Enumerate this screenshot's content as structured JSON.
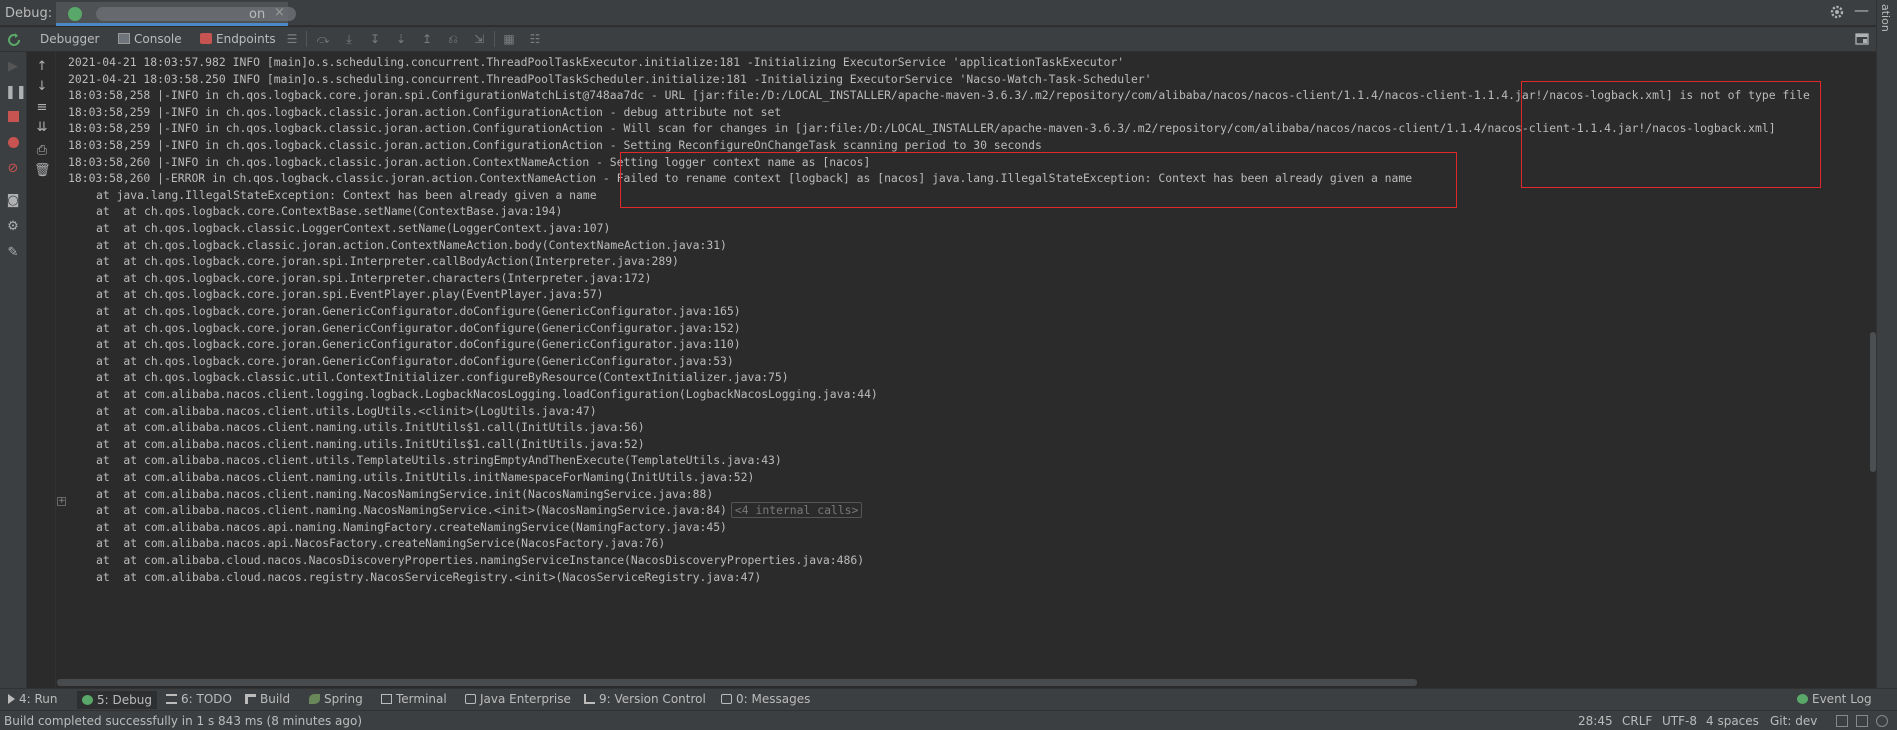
{
  "titlebar": {
    "debug_label": "Debug:",
    "run_tab_name_suffix": "on",
    "close_glyph": "×",
    "minimize_glyph": "—"
  },
  "right_strip": {
    "label": "ation"
  },
  "toolbar2": {
    "tabs": [
      {
        "label": "Debugger"
      },
      {
        "label": "Console"
      },
      {
        "label": "Endpoints"
      }
    ],
    "menu_glyph": "☰"
  },
  "console": {
    "lines": [
      {
        "text": "2021-04-21 18:03:57.982 INFO [main]o.s.scheduling.concurrent.ThreadPoolTaskExecutor.initialize:181 -Initializing ExecutorService 'applicationTaskExecutor'"
      },
      {
        "text": "2021-04-21 18:03:58.250 INFO [main]o.s.scheduling.concurrent.ThreadPoolTaskScheduler.initialize:181 -Initializing ExecutorService 'Nacso-Watch-Task-Scheduler'"
      },
      {
        "text": "18:03:58,258 |-INFO in ch.qos.logback.core.joran.spi.ConfigurationWatchList@748aa7dc - URL [jar:file:/D:/LOCAL_INSTALLER/apache-maven-3.6.3/.m2/repository/com/alibaba/nacos/nacos-client/1.1.4/nacos-client-1.1.4.jar!/nacos-logback.xml] is not of type file"
      },
      {
        "text": "18:03:58,259 |-INFO in ch.qos.logback.classic.joran.action.ConfigurationAction - debug attribute not set"
      },
      {
        "text": "18:03:58,259 |-INFO in ch.qos.logback.classic.joran.action.ConfigurationAction - Will scan for changes in [jar:file:/D:/LOCAL_INSTALLER/apache-maven-3.6.3/.m2/repository/com/alibaba/nacos/nacos-client/1.1.4/nacos-client-1.1.4.jar!/nacos-logback.xml]"
      },
      {
        "text": "18:03:58,259 |-INFO in ch.qos.logback.classic.joran.action.ConfigurationAction - Setting ReconfigureOnChangeTask scanning period to 30 seconds"
      },
      {
        "text": "18:03:58,260 |-INFO in ch.qos.logback.classic.joran.action.ContextNameAction - Setting logger context name as [nacos]"
      },
      {
        "text": "18:03:58,260 |-ERROR in ch.qos.logback.classic.joran.action.ContextNameAction - Failed to rename context [logback] as [nacos] java.lang.IllegalStateException: Context has been already given a name"
      }
    ],
    "stack_lines": [
      {
        "text": "at java.lang.IllegalStateException: Context has been already given a name"
      },
      {
        "text": "at  at ch.qos.logback.core.ContextBase.setName(ContextBase.java:194)"
      },
      {
        "text": "at  at ch.qos.logback.classic.LoggerContext.setName(LoggerContext.java:107)"
      },
      {
        "text": "at  at ch.qos.logback.classic.joran.action.ContextNameAction.body(ContextNameAction.java:31)"
      },
      {
        "text": "at  at ch.qos.logback.core.joran.spi.Interpreter.callBodyAction(Interpreter.java:289)"
      },
      {
        "text": "at  at ch.qos.logback.core.joran.spi.Interpreter.characters(Interpreter.java:172)"
      },
      {
        "text": "at  at ch.qos.logback.core.joran.spi.EventPlayer.play(EventPlayer.java:57)"
      },
      {
        "text": "at  at ch.qos.logback.core.joran.GenericConfigurator.doConfigure(GenericConfigurator.java:165)"
      },
      {
        "text": "at  at ch.qos.logback.core.joran.GenericConfigurator.doConfigure(GenericConfigurator.java:152)"
      },
      {
        "text": "at  at ch.qos.logback.core.joran.GenericConfigurator.doConfigure(GenericConfigurator.java:110)"
      },
      {
        "text": "at  at ch.qos.logback.core.joran.GenericConfigurator.doConfigure(GenericConfigurator.java:53)"
      },
      {
        "text": "at  at ch.qos.logback.classic.util.ContextInitializer.configureByResource(ContextInitializer.java:75)"
      },
      {
        "text": "at  at com.alibaba.nacos.client.logging.logback.LogbackNacosLogging.loadConfiguration(LogbackNacosLogging.java:44)"
      },
      {
        "text": "at  at com.alibaba.nacos.client.utils.LogUtils.<clinit>(LogUtils.java:47)"
      },
      {
        "text": "at  at com.alibaba.nacos.client.naming.utils.InitUtils$1.call(InitUtils.java:56)"
      },
      {
        "text": "at  at com.alibaba.nacos.client.naming.utils.InitUtils$1.call(InitUtils.java:52)"
      },
      {
        "text": "at  at com.alibaba.nacos.client.utils.TemplateUtils.stringEmptyAndThenExecute(TemplateUtils.java:43)"
      },
      {
        "text": "at  at com.alibaba.nacos.client.naming.utils.InitUtils.initNamespaceForNaming(InitUtils.java:52)"
      },
      {
        "text": "at  at com.alibaba.nacos.client.naming.NacosNamingService.init(NacosNamingService.java:88)"
      },
      {
        "text": "at  at com.alibaba.nacos.client.naming.NacosNamingService.<init>(NacosNamingService.java:84)",
        "internal": "<4 internal calls>"
      },
      {
        "text": "at  at com.alibaba.nacos.api.naming.NamingFactory.createNamingService(NamingFactory.java:45)"
      },
      {
        "text": "at  at com.alibaba.nacos.api.NacosFactory.createNamingService(NacosFactory.java:76)"
      },
      {
        "text": "at  at com.alibaba.cloud.nacos.NacosDiscoveryProperties.namingServiceInstance(NacosDiscoveryProperties.java:486)"
      },
      {
        "text": "at  at com.alibaba.cloud.nacos.registry.NacosServiceRegistry.<init>(NacosServiceRegistry.java:47)"
      }
    ]
  },
  "bottom_tabs": [
    {
      "label": "4: Run"
    },
    {
      "label": "5: Debug"
    },
    {
      "label": "6: TODO"
    },
    {
      "label": "Build"
    },
    {
      "label": "Spring"
    },
    {
      "label": "Terminal"
    },
    {
      "label": "Java Enterprise"
    },
    {
      "label": "9: Version Control"
    },
    {
      "label": "0: Messages"
    },
    {
      "label": "Event Log"
    }
  ],
  "statusbar": {
    "message": "Build completed successfully in 1 s 843 ms (8 minutes ago)",
    "position": "28:45",
    "line_separator": "CRLF",
    "encoding": "UTF-8",
    "indent": "4 spaces",
    "vcs_branch": "Git: dev"
  },
  "colors": {
    "background": "#2b2b2b",
    "panel": "#3c3f41",
    "text": "#bbbbbb",
    "highlight_box": "#e0282e",
    "accent": "#4a88c7"
  }
}
